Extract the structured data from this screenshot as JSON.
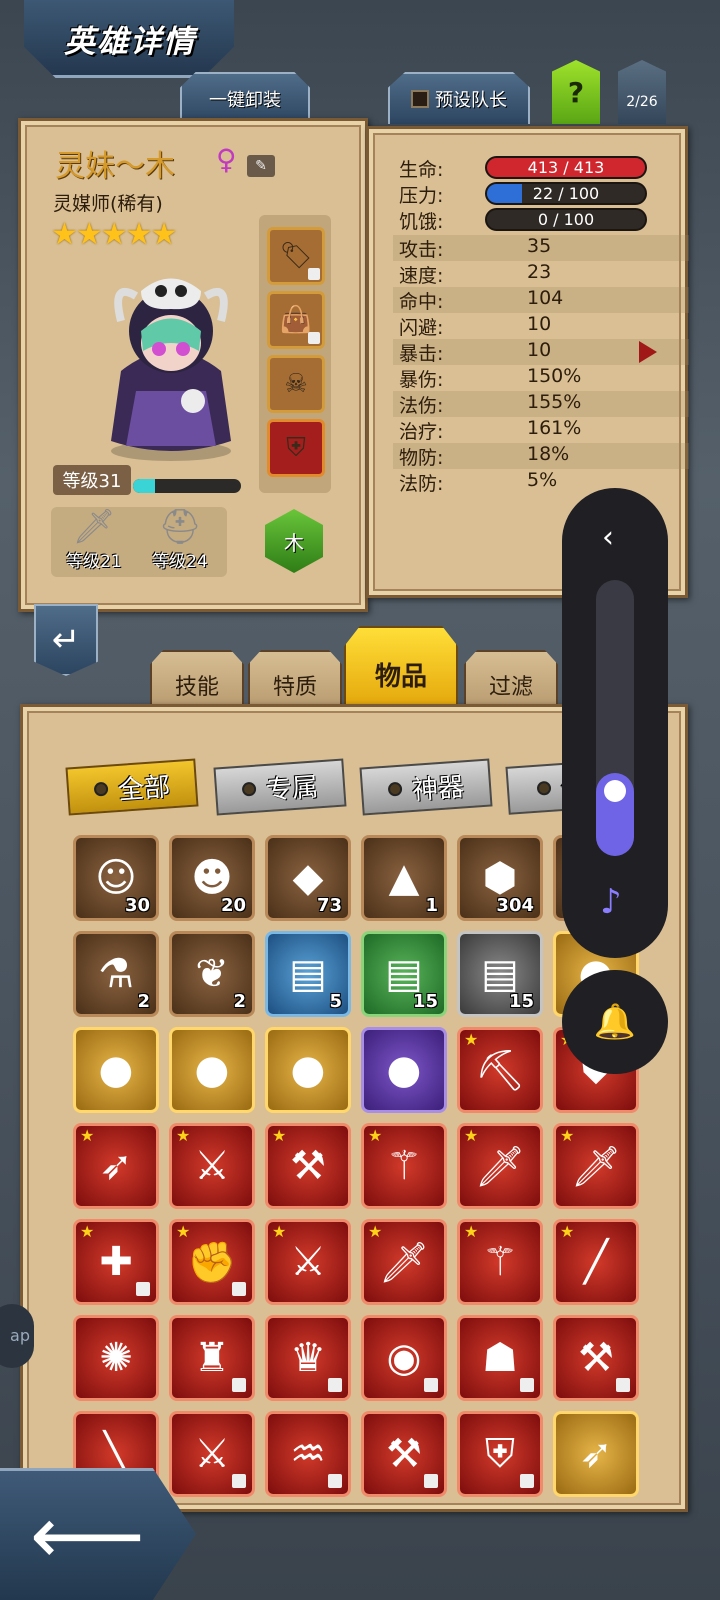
{
  "header": {
    "title": "英雄详情",
    "unequip_all": "一键卸装",
    "preset_leader": "预设队长",
    "help": "?",
    "page_count": "2/26"
  },
  "hero": {
    "name": "灵妹～木",
    "gender_symbol": "♀",
    "class": "灵媒师(稀有)",
    "stars": "★★★★★",
    "level_label": "等级31",
    "exp_fraction": 0.2,
    "weapon_level": "等级21",
    "armor_level": "等级24",
    "element": "木"
  },
  "stats": {
    "hp": {
      "label": "生命:",
      "value": "413 / 413",
      "fraction": 1.0,
      "color": "#d0262e"
    },
    "stress": {
      "label": "压力:",
      "value": "22 / 100",
      "fraction": 0.22,
      "color": "#2d6fd6"
    },
    "hunger": {
      "label": "饥饿:",
      "value": "0 / 100",
      "fraction": 0.0,
      "color": "#555"
    },
    "rows": [
      {
        "label": "攻击:",
        "value": "35"
      },
      {
        "label": "速度:",
        "value": "23"
      },
      {
        "label": "命中:",
        "value": "104"
      },
      {
        "label": "闪避:",
        "value": "10"
      },
      {
        "label": "暴击:",
        "value": "10"
      },
      {
        "label": "暴伤:",
        "value": "150%"
      },
      {
        "label": "法伤:",
        "value": "155%"
      },
      {
        "label": "治疗:",
        "value": "161%"
      },
      {
        "label": "物防:",
        "value": "18%"
      },
      {
        "label": "法防:",
        "value": "5%"
      }
    ]
  },
  "tabs": {
    "skills": "技能",
    "traits": "特质",
    "items": "物品",
    "filter": "过滤"
  },
  "filters": {
    "all": "全部",
    "exclusive": "专属",
    "artifact": "神器",
    "partial": "传"
  },
  "items": {
    "row1": [
      {
        "icon": "hero-green-hair-icon",
        "glyph": "☺",
        "count": "30",
        "rarity": "brown"
      },
      {
        "icon": "hero-brown-hair-icon",
        "glyph": "☻",
        "count": "20",
        "rarity": "brown"
      },
      {
        "icon": "orange-gem-icon",
        "glyph": "◆",
        "count": "73",
        "rarity": "brown"
      },
      {
        "icon": "gold-ore-pile-icon",
        "glyph": "▲",
        "count": "1",
        "rarity": "brown"
      },
      {
        "icon": "teal-rune-icon",
        "glyph": "⬢",
        "count": "304",
        "rarity": "brown"
      },
      {
        "icon": "partial-item-icon",
        "glyph": "",
        "count": "",
        "rarity": "brown"
      }
    ],
    "row2": [
      {
        "icon": "blue-potion-icon",
        "glyph": "⚗",
        "count": "2",
        "rarity": "brown"
      },
      {
        "icon": "white-feather-icon",
        "glyph": "❦",
        "count": "2",
        "rarity": "brown"
      },
      {
        "icon": "blue-chest-icon",
        "glyph": "▤",
        "count": "5",
        "rarity": "blue"
      },
      {
        "icon": "green-chest-icon",
        "glyph": "▤",
        "count": "15",
        "rarity": "green"
      },
      {
        "icon": "grey-chest-icon",
        "glyph": "▤",
        "count": "15",
        "rarity": "grey"
      },
      {
        "icon": "green-orb-icon",
        "glyph": "●",
        "count": "",
        "rarity": "gold"
      }
    ],
    "row3": [
      {
        "icon": "green-orb-icon",
        "glyph": "●",
        "count": "",
        "rarity": "gold"
      },
      {
        "icon": "green-orb-icon",
        "glyph": "●",
        "count": "",
        "rarity": "gold"
      },
      {
        "icon": "green-orb-icon",
        "glyph": "●",
        "count": "",
        "rarity": "gold"
      },
      {
        "icon": "green-orb-icon",
        "glyph": "●",
        "count": "",
        "rarity": "purple"
      },
      {
        "icon": "pickaxe-icon",
        "glyph": "⛏",
        "count": "",
        "rarity": "red"
      },
      {
        "icon": "shield-icon",
        "glyph": "⛊",
        "count": "",
        "rarity": "red"
      }
    ],
    "row4": [
      {
        "icon": "bow-icon",
        "glyph": "➶",
        "count": "",
        "rarity": "red"
      },
      {
        "icon": "rifle-icon",
        "glyph": "⚔",
        "count": "",
        "rarity": "red"
      },
      {
        "icon": "axe-icon",
        "glyph": "⚒",
        "count": "",
        "rarity": "red"
      },
      {
        "icon": "staff-icon",
        "glyph": "⚚",
        "count": "",
        "rarity": "red"
      },
      {
        "icon": "flame-sword-icon",
        "glyph": "🗡",
        "count": "",
        "rarity": "red"
      },
      {
        "icon": "flame-sword-icon",
        "glyph": "🗡",
        "count": "",
        "rarity": "red"
      }
    ],
    "row5": [
      {
        "icon": "medkit-icon",
        "glyph": "✚",
        "count": "",
        "rarity": "red"
      },
      {
        "icon": "gauntlet-icon",
        "glyph": "✊",
        "count": "",
        "rarity": "red"
      },
      {
        "icon": "sword-icon",
        "glyph": "⚔",
        "count": "",
        "rarity": "red"
      },
      {
        "icon": "rapier-icon",
        "glyph": "🗡",
        "count": "",
        "rarity": "red"
      },
      {
        "icon": "mace-icon",
        "glyph": "⚚",
        "count": "",
        "rarity": "red"
      },
      {
        "icon": "cane-icon",
        "glyph": "╱",
        "count": "",
        "rarity": "red"
      }
    ],
    "row6": [
      {
        "icon": "storm-orb-icon",
        "glyph": "✺",
        "count": "",
        "rarity": "red"
      },
      {
        "icon": "robe-icon",
        "glyph": "♜",
        "count": "",
        "rarity": "red"
      },
      {
        "icon": "winged-helmet-icon",
        "glyph": "♛",
        "count": "",
        "rarity": "red"
      },
      {
        "icon": "crystal-orb-icon",
        "glyph": "◉",
        "count": "",
        "rarity": "red"
      },
      {
        "icon": "gold-helmet-icon",
        "glyph": "☗",
        "count": "",
        "rarity": "red"
      },
      {
        "icon": "hammer-icon",
        "glyph": "⚒",
        "count": "",
        "rarity": "red"
      }
    ],
    "row7": [
      {
        "icon": "red-blade-icon",
        "glyph": "╲",
        "count": "",
        "rarity": "red"
      },
      {
        "icon": "blue-sword-icon",
        "glyph": "⚔",
        "count": "",
        "rarity": "red"
      },
      {
        "icon": "horn-icon",
        "glyph": "♒",
        "count": "",
        "rarity": "red"
      },
      {
        "icon": "double-axe-icon",
        "glyph": "⚒",
        "count": "",
        "rarity": "red"
      },
      {
        "icon": "armor-icon",
        "glyph": "⛨",
        "count": "",
        "rarity": "red"
      },
      {
        "icon": "crossbow-icon",
        "glyph": "➶",
        "count": "",
        "rarity": "gold"
      }
    ]
  }
}
